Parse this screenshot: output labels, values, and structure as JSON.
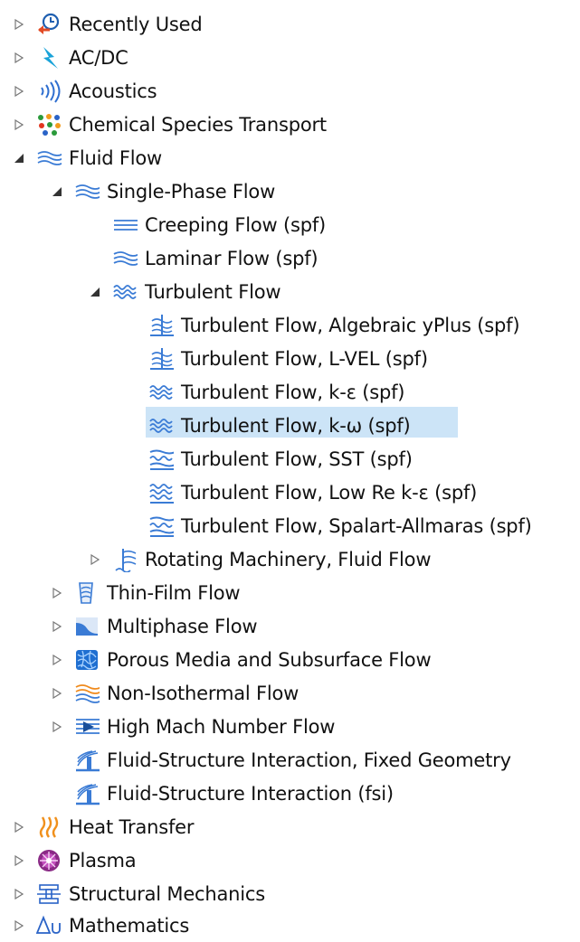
{
  "tree": {
    "items": [
      {
        "label": "Recently Used"
      },
      {
        "label": "AC/DC"
      },
      {
        "label": "Acoustics"
      },
      {
        "label": "Chemical Species Transport"
      },
      {
        "label": "Fluid Flow"
      },
      {
        "label": "Single-Phase Flow"
      },
      {
        "label": "Creeping Flow (spf)"
      },
      {
        "label": "Laminar Flow (spf)"
      },
      {
        "label": "Turbulent Flow"
      },
      {
        "label": "Turbulent Flow, Algebraic yPlus (spf)"
      },
      {
        "label": "Turbulent Flow, L-VEL (spf)"
      },
      {
        "label": "Turbulent Flow, k-ε (spf)"
      },
      {
        "label": "Turbulent Flow, k-ω (spf)"
      },
      {
        "label": "Turbulent Flow, SST (spf)"
      },
      {
        "label": "Turbulent Flow, Low Re k-ε (spf)"
      },
      {
        "label": "Turbulent Flow, Spalart-Allmaras (spf)"
      },
      {
        "label": "Rotating Machinery, Fluid Flow"
      },
      {
        "label": "Thin-Film Flow"
      },
      {
        "label": "Multiphase Flow"
      },
      {
        "label": "Porous Media and Subsurface Flow"
      },
      {
        "label": "Non-Isothermal Flow"
      },
      {
        "label": "High Mach Number Flow"
      },
      {
        "label": "Fluid-Structure Interaction, Fixed Geometry"
      },
      {
        "label": "Fluid-Structure Interaction (fsi)"
      },
      {
        "label": "Heat Transfer"
      },
      {
        "label": "Plasma"
      },
      {
        "label": "Structural Mechanics"
      },
      {
        "label": "Mathematics"
      }
    ],
    "selected_label": "Turbulent Flow, k-ω (spf)"
  },
  "colors": {
    "selection": "#cce4f7",
    "flow_icon": "#3a7bd5",
    "toggle": "#666666"
  }
}
